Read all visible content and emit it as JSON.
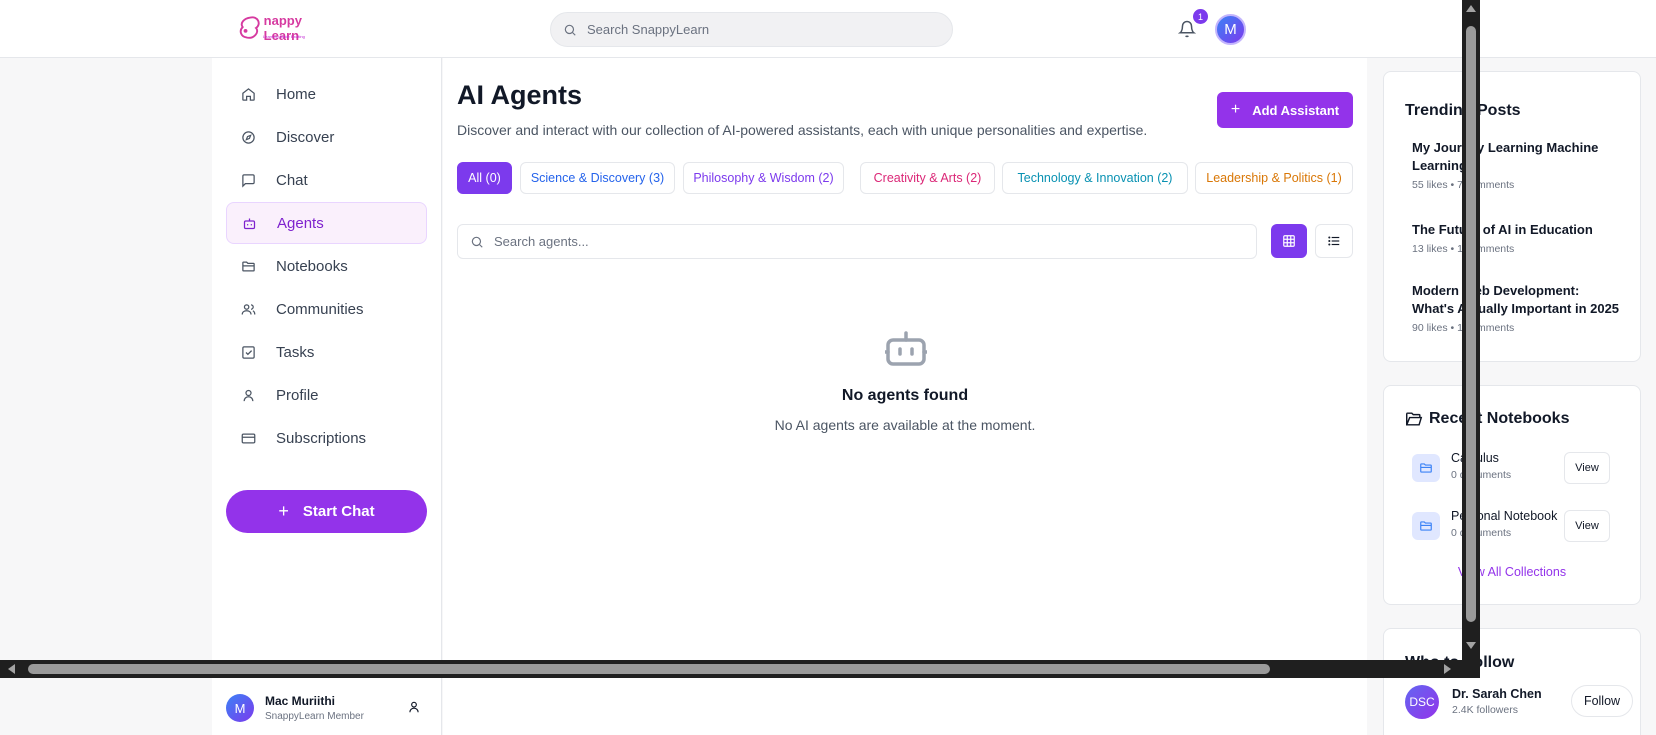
{
  "header": {
    "logo_text": "nappy Learn",
    "logo_tagline": "Learning Made Exciting",
    "search_placeholder": "Search SnappyLearn",
    "notification_count": "1",
    "avatar_initial": "M"
  },
  "sidebar": {
    "items": [
      {
        "label": "Home",
        "icon": "home-icon"
      },
      {
        "label": "Discover",
        "icon": "compass-icon"
      },
      {
        "label": "Chat",
        "icon": "message-icon"
      },
      {
        "label": "Agents",
        "icon": "bot-icon",
        "active": true
      },
      {
        "label": "Notebooks",
        "icon": "folder-icon"
      },
      {
        "label": "Communities",
        "icon": "users-icon"
      },
      {
        "label": "Tasks",
        "icon": "check-square-icon"
      },
      {
        "label": "Profile",
        "icon": "user-icon"
      },
      {
        "label": "Subscriptions",
        "icon": "credit-card-icon"
      }
    ],
    "start_chat_label": "Start Chat",
    "user": {
      "initial": "M",
      "name": "Mac Muriithi",
      "role": "SnappyLearn Member"
    }
  },
  "main": {
    "title": "AI Agents",
    "description": "Discover and interact with our collection of AI-powered assistants, each with unique personalities and expertise.",
    "add_button_label": "Add Assistant",
    "filters": [
      {
        "label": "All (0)",
        "color": "#ffffff",
        "active": true
      },
      {
        "label": "Science & Discovery (3)",
        "color": "#2563eb"
      },
      {
        "label": "Philosophy & Wisdom (2)",
        "color": "#7c3aed"
      },
      {
        "label": "Creativity & Arts (2)",
        "color": "#db2777"
      },
      {
        "label": "Technology & Innovation (2)",
        "color": "#0891b2"
      },
      {
        "label": "Leadership & Politics (1)",
        "color": "#d97706"
      }
    ],
    "agent_search_placeholder": "Search agents...",
    "empty_title": "No agents found",
    "empty_subtitle": "No AI agents are available at the moment."
  },
  "right": {
    "trending": {
      "title": "Trending Posts",
      "posts": [
        {
          "title": "My Journey Learning Machine Learning",
          "meta": "55 likes • 7 comments"
        },
        {
          "title": "The Future of AI in Education",
          "meta": "13 likes • 1 comments"
        },
        {
          "title": "Modern Web Development: What's Actually Important in 2025",
          "meta": "90 likes • 1 comments"
        }
      ]
    },
    "notebooks": {
      "title": "Recent Notebooks",
      "items": [
        {
          "name": "Calculus",
          "count": "0 documents",
          "view": "View"
        },
        {
          "name": "Personal Notebook",
          "count": "0 documents",
          "view": "View"
        }
      ],
      "view_all": "View All Collections"
    },
    "follow": {
      "title": "Who to Follow",
      "people": [
        {
          "initials": "DSC",
          "name": "Dr. Sarah Chen",
          "followers": "2.4K followers",
          "button": "Follow"
        }
      ]
    }
  },
  "colors": {
    "accent": "#9333ea",
    "accent_dark": "#7c3aed",
    "border": "#e5e7eb"
  }
}
